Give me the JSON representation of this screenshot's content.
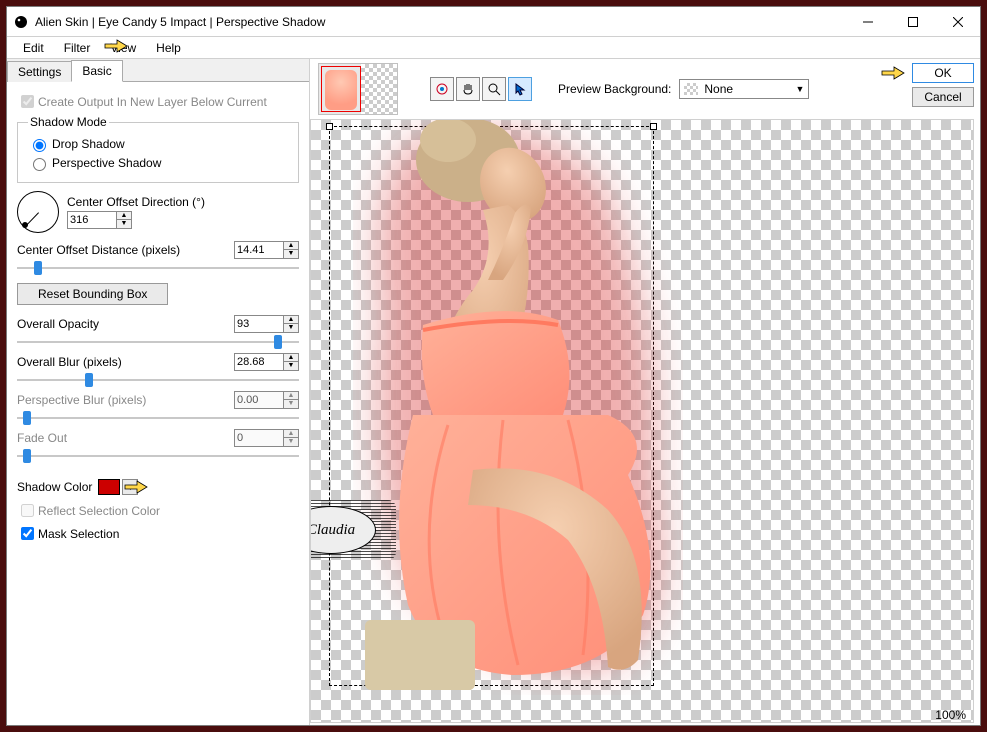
{
  "window": {
    "title": "Alien Skin | Eye Candy 5 Impact | Perspective Shadow"
  },
  "menu": {
    "edit": "Edit",
    "filter": "Filter",
    "view": "View",
    "help": "Help"
  },
  "tabs": {
    "settings": "Settings",
    "basic": "Basic"
  },
  "panel": {
    "create_output_label": "Create Output In New Layer Below Current",
    "shadow_mode_legend": "Shadow Mode",
    "drop_shadow": "Drop Shadow",
    "perspective_shadow": "Perspective Shadow",
    "center_offset_direction_label": "Center Offset Direction (°)",
    "center_offset_direction_value": "316",
    "center_offset_distance_label": "Center Offset Distance (pixels)",
    "center_offset_distance_value": "14.41",
    "reset_bounding_box": "Reset Bounding Box",
    "overall_opacity_label": "Overall Opacity",
    "overall_opacity_value": "93",
    "overall_blur_label": "Overall Blur (pixels)",
    "overall_blur_value": "28.68",
    "perspective_blur_label": "Perspective Blur (pixels)",
    "perspective_blur_value": "0.00",
    "fade_out_label": "Fade Out",
    "fade_out_value": "0",
    "shadow_color_label": "Shadow Color",
    "shadow_color_hex": "#cc0000",
    "reflect_selection_color": "Reflect Selection Color",
    "mask_selection": "Mask Selection"
  },
  "preview": {
    "background_label": "Preview Background:",
    "background_value": "None",
    "zoom": "100%"
  },
  "buttons": {
    "ok": "OK",
    "cancel": "Cancel"
  },
  "watermark": {
    "text": "Claudia"
  }
}
